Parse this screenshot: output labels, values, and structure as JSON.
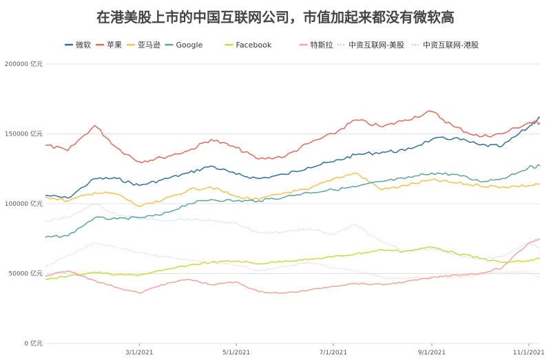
{
  "chart_data": {
    "type": "line",
    "title": "在港美股上市的中国互联网公司，市值加起来都没有微软高",
    "xlabel": "",
    "ylabel": "",
    "ylim": [
      0,
      200000
    ],
    "y_ticks": [
      0,
      50000,
      100000,
      150000,
      200000
    ],
    "y_tick_labels": [
      "0 亿元",
      "50000 亿元",
      "100000 亿元",
      "150000 亿元",
      "200000 亿元"
    ],
    "x_range": [
      "2021-01-01",
      "2021-11-08"
    ],
    "x_ticks": [
      "2021-03-01",
      "2021-05-01",
      "2021-07-01",
      "2021-09-01",
      "2021-11-01"
    ],
    "x_tick_labels": [
      "3/1/2021",
      "5/1/2021",
      "7/1/2021",
      "9/1/2021",
      "11/1/2021"
    ],
    "grid": true,
    "legend_position": "top",
    "x": [
      "2021-01-01",
      "2021-01-15",
      "2021-02-01",
      "2021-02-15",
      "2021-03-01",
      "2021-03-15",
      "2021-04-01",
      "2021-04-15",
      "2021-05-01",
      "2021-05-15",
      "2021-06-01",
      "2021-06-15",
      "2021-07-01",
      "2021-07-15",
      "2021-08-01",
      "2021-08-15",
      "2021-09-01",
      "2021-09-15",
      "2021-10-01",
      "2021-10-15",
      "2021-11-01",
      "2021-11-08"
    ],
    "series": [
      {
        "name": "微软",
        "color": "#2e7197",
        "dash": "",
        "values": [
          106000,
          104000,
          118000,
          118000,
          113000,
          117000,
          122000,
          127000,
          121000,
          118000,
          121000,
          126000,
          130000,
          135000,
          137000,
          138000,
          146000,
          147000,
          142000,
          141000,
          155000,
          162000
        ]
      },
      {
        "name": "苹果",
        "color": "#e06a5a",
        "dash": "",
        "values": [
          142000,
          138000,
          156000,
          140000,
          130000,
          133000,
          138000,
          146000,
          140000,
          132000,
          134000,
          143000,
          150000,
          160000,
          155000,
          160000,
          166000,
          155000,
          148000,
          150000,
          158000,
          158000
        ]
      },
      {
        "name": "亚马逊",
        "color": "#f2c14e",
        "dash": "",
        "values": [
          105000,
          102000,
          108000,
          107000,
          98000,
          102000,
          110000,
          112000,
          105000,
          103000,
          108000,
          110000,
          118000,
          122000,
          110000,
          113000,
          117000,
          115000,
          113000,
          112000,
          113000,
          114000
        ]
      },
      {
        "name": "Google",
        "color": "#5aa3a0",
        "dash": "",
        "values": [
          76000,
          77000,
          90000,
          89000,
          90000,
          92000,
          100000,
          103000,
          102000,
          102000,
          105000,
          108000,
          110000,
          112000,
          116000,
          118000,
          122000,
          121000,
          116000,
          118000,
          126000,
          127000
        ]
      },
      {
        "name": "Facebook",
        "color": "#c8da3c",
        "dash": "",
        "values": [
          46000,
          48000,
          51000,
          49000,
          49000,
          52000,
          56000,
          58000,
          59000,
          57000,
          59000,
          60000,
          62000,
          64000,
          67000,
          66000,
          69000,
          65000,
          61000,
          58000,
          59000,
          61000
        ]
      },
      {
        "name": "特斯拉",
        "color": "#f2a39a",
        "dash": "",
        "values": [
          48000,
          52000,
          45000,
          40000,
          36000,
          42000,
          46000,
          42000,
          44000,
          37000,
          36000,
          38000,
          41000,
          43000,
          42000,
          44000,
          47000,
          49000,
          50000,
          54000,
          72000,
          75000
        ]
      },
      {
        "name": "中资互联网-美股",
        "color": "#b8d3e3",
        "dash": "1.5 1.5",
        "values": [
          88000,
          90000,
          100000,
          92000,
          89000,
          88000,
          89000,
          88000,
          86000,
          79000,
          80000,
          82000,
          78000,
          85000,
          72000,
          66000,
          68000,
          64000,
          60000,
          62000,
          72000,
          68000
        ]
      },
      {
        "name": "中资互联网-港股",
        "color": "#f7c3be",
        "dash": "1.5 1.5",
        "values": [
          55000,
          63000,
          72000,
          69000,
          65000,
          62000,
          60000,
          58000,
          56000,
          52000,
          55000,
          58000,
          54000,
          52000,
          47000,
          46000,
          48000,
          47000,
          49000,
          51000,
          51000,
          47000
        ]
      }
    ]
  }
}
